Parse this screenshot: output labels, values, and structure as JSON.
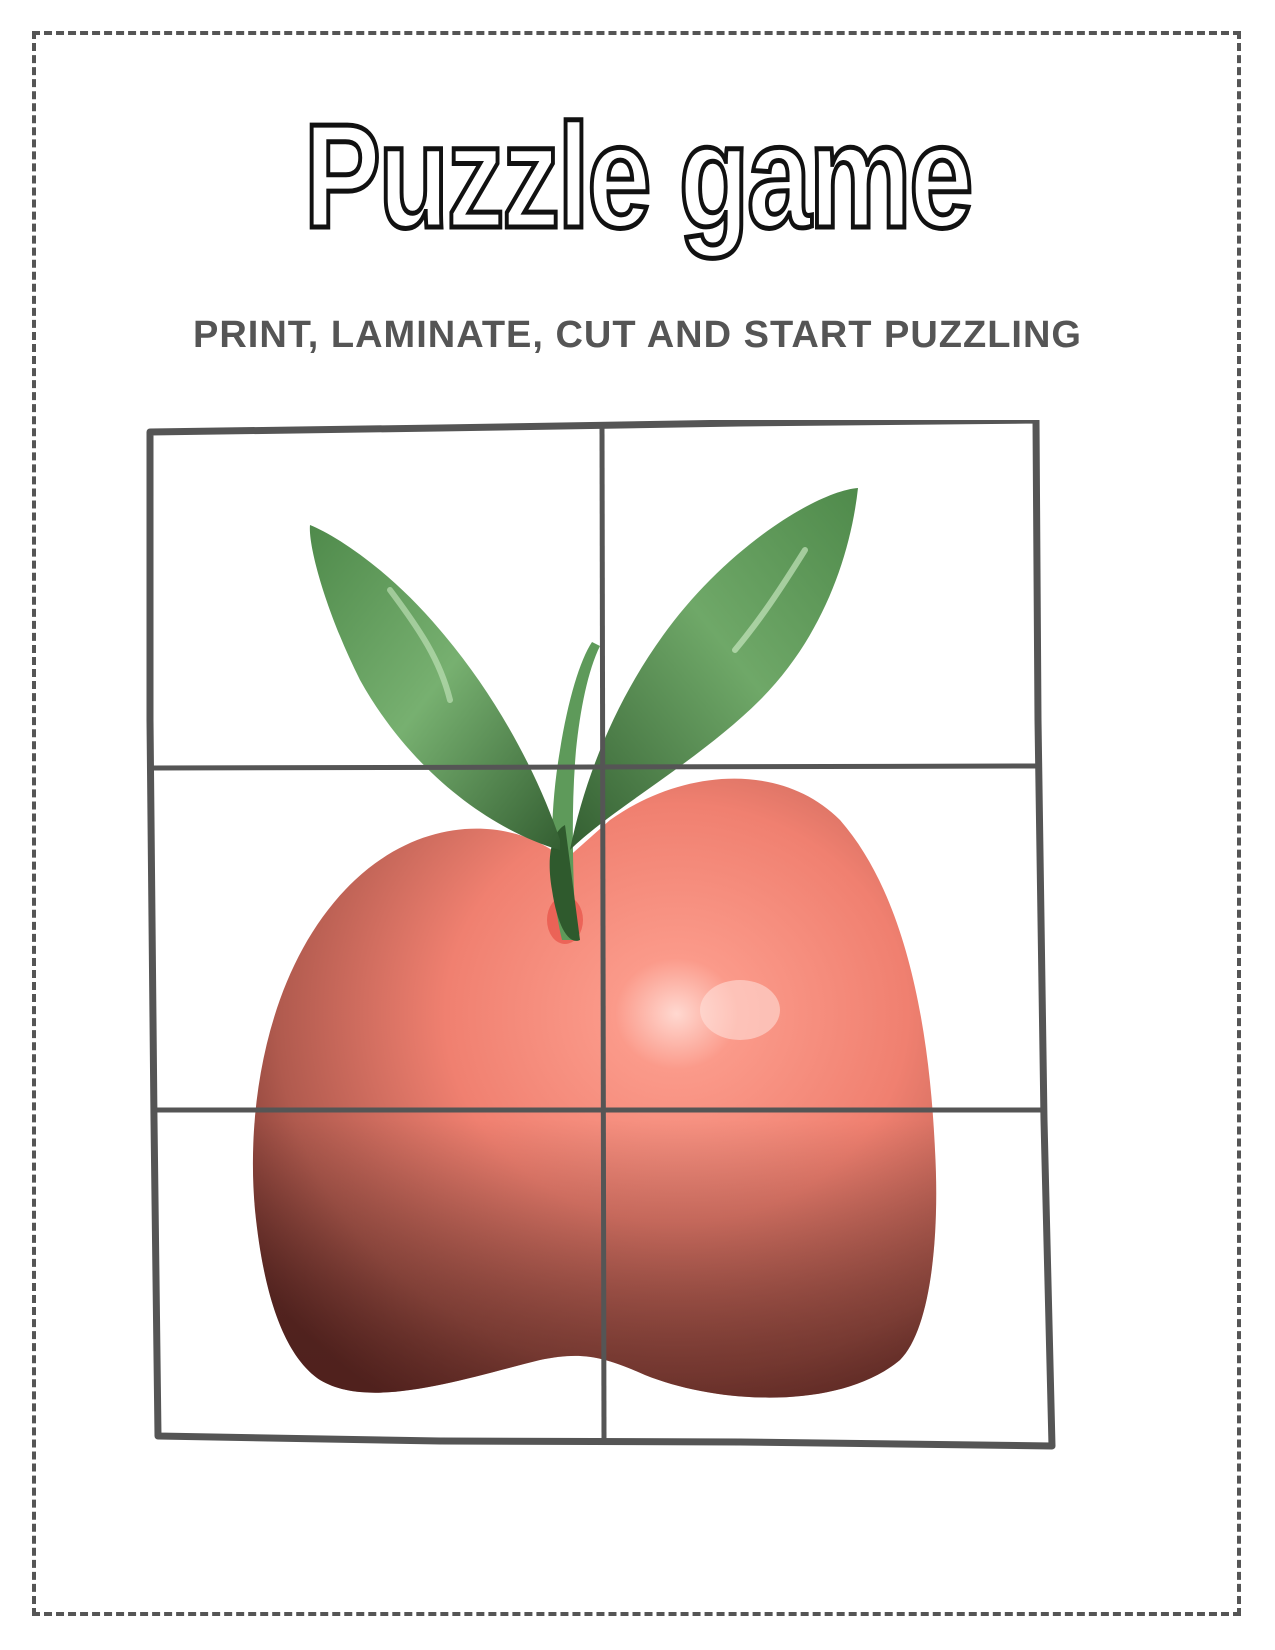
{
  "worksheet": {
    "title": "Puzzle game",
    "subtitle": "PRINT, LAMINATE, CUT AND START PUZZLING"
  },
  "puzzle": {
    "picture": "apple-with-leaves",
    "rows": 3,
    "columns": 2,
    "colors": {
      "apple": "#f08070",
      "apple_shadow": "#6b2f2a",
      "leaf": "#5e9a5a",
      "leaf_dark": "#3d6e3b",
      "grid": "#555555",
      "frame": "#555555"
    }
  }
}
